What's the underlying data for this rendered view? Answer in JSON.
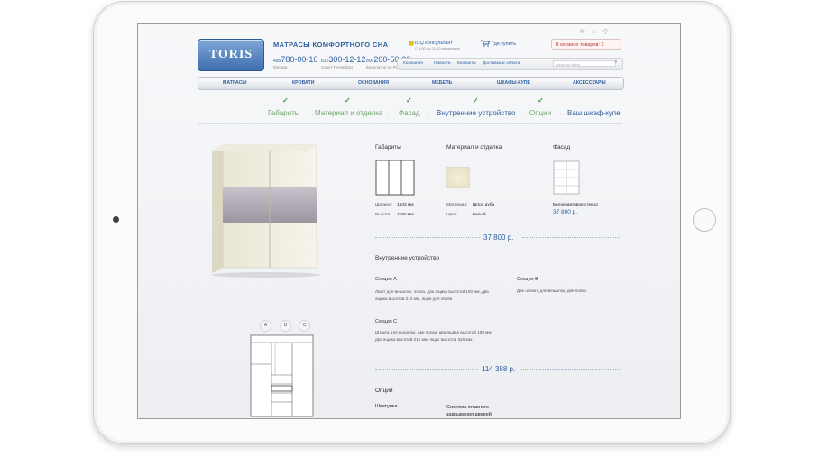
{
  "header": {
    "logo": "TORIS",
    "tagline": "МАТРАСЫ КОМФОРТНОГО СНА",
    "phones": [
      {
        "code": "495",
        "number": "780-00-10",
        "caption": "Москва"
      },
      {
        "code": "812",
        "number": "300-12-12",
        "caption": "Санкт-Петербург"
      },
      {
        "code": "800",
        "number": "200-50-60",
        "caption": "Бесплатно по России"
      }
    ],
    "icq": {
      "label": "ICQ консультант",
      "hours": "С 9:00 до 21:00 ежедневно"
    },
    "buy_label": "Где купить",
    "cart_label": "В корзине товаров: 2",
    "topnav": [
      "Компания",
      "Новости",
      "Контакты",
      "Доставка и оплата"
    ],
    "search_placeholder": "поиск по сайту",
    "go": "»"
  },
  "mainnav": [
    "МАТРАСЫ",
    "КРОВАТИ",
    "ОСНОВАНИЯ",
    "МЕБЕЛЬ",
    "ШКАФЫ-КУПЕ",
    "АКСЕССУАРЫ"
  ],
  "steps": [
    "Габариты",
    "Материал и отделка",
    "Фасад",
    "Внутренние устройство",
    "Опции",
    "Ваш шкаф-купе"
  ],
  "step_sep": "→",
  "check": "✓",
  "views": [
    "A",
    "B",
    "C"
  ],
  "summary": {
    "dims": {
      "title": "Габариты",
      "width_label": "Ширина:",
      "width": "1503 мм",
      "height_label": "Высота:",
      "height": "2150 мм"
    },
    "material": {
      "title": "Материал и отделка",
      "mat_label": "Материал:",
      "mat": "Шпон дуба",
      "color_label": "Цвет:",
      "color": "Белый"
    },
    "facade": {
      "title": "Фасад",
      "name": "Белое матовое стекло",
      "price": "37 800 р."
    },
    "total1": "37 800 р."
  },
  "interior": {
    "title": "Внутренние устройство",
    "secA": {
      "title": "Секция A",
      "text": "Лифт для вешалок, полка, два ящика высотой 100 мм, два ящика высотой 210 мм, ящик для обуви"
    },
    "secB": {
      "title": "Секция B",
      "text": "Две штанги для вешалок, две полки"
    },
    "secC": {
      "title": "Секция C",
      "text": "Штанга для вешалок, две полки, два ящика высотой 100 мм, два ящика высотой 210 мм, ящик высотой 320 мм."
    },
    "total": "114 388 р."
  },
  "options": {
    "title": "Опции",
    "items": [
      "Шкатулка",
      "Система плавного закрывания дверей"
    ]
  }
}
